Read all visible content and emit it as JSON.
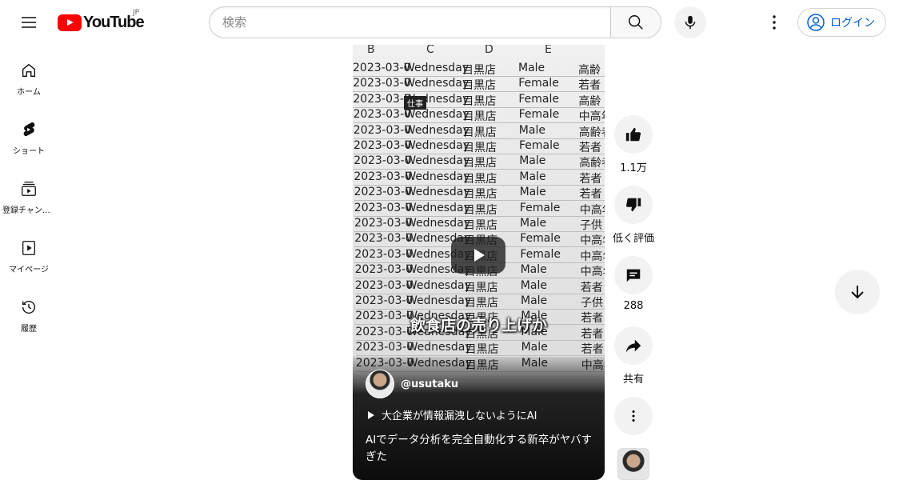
{
  "header": {
    "logo_text": "YouTube",
    "logo_region": "JP",
    "search_placeholder": "検索",
    "login_label": "ログイン"
  },
  "guide": {
    "items": [
      {
        "label": "ホーム",
        "icon": "home-icon"
      },
      {
        "label": "ショート",
        "icon": "shorts-icon"
      },
      {
        "label": "登録チャンネル",
        "icon": "subscriptions-icon"
      },
      {
        "label": "マイページ",
        "icon": "library-icon"
      },
      {
        "label": "履歴",
        "icon": "history-icon"
      }
    ]
  },
  "short": {
    "sheet_columns": [
      "B",
      "C",
      "D",
      "E"
    ],
    "sheet_tag": "仕事",
    "sheet_rows": [
      [
        "2023-03-0",
        "Wednesday",
        "目黒店",
        "Male",
        "高齢"
      ],
      [
        "2023-03-0",
        "Wednesday",
        "目黒店",
        "Female",
        "若者"
      ],
      [
        "2023-03-0",
        "Wednesday",
        "目黒店",
        "Female",
        "高齢"
      ],
      [
        "2023-03-0",
        "Wednesday",
        "目黒店",
        "Female",
        "中高年"
      ],
      [
        "2023-03-0",
        "Wednesday",
        "目黒店",
        "Male",
        "高齢者"
      ],
      [
        "2023-03-0",
        "Wednesday",
        "目黒店",
        "Female",
        "若者"
      ],
      [
        "2023-03-0",
        "Wednesday",
        "目黒店",
        "Male",
        "高齢者"
      ],
      [
        "2023-03-0",
        "Wednesday",
        "目黒店",
        "Male",
        "若者"
      ],
      [
        "2023-03-0",
        "Wednesday",
        "目黒店",
        "Male",
        "若者"
      ],
      [
        "2023-03-0",
        "Wednesday",
        "目黒店",
        "Female",
        "中高年"
      ],
      [
        "2023-03-0",
        "Wednesday",
        "目黒店",
        "Male",
        "子供"
      ],
      [
        "2023-03-0",
        "Wednesday",
        "目黒店",
        "Female",
        "中高年"
      ],
      [
        "2023-03-0",
        "Wednesday",
        "目黒店",
        "Female",
        "中高年"
      ],
      [
        "2023-03-0",
        "Wednesday",
        "目黒店",
        "Male",
        "中高年"
      ],
      [
        "2023-03-0",
        "Wednesday",
        "目黒店",
        "Male",
        "若者"
      ],
      [
        "2023-03-0",
        "Wednesday",
        "目黒店",
        "Male",
        "子供"
      ],
      [
        "2023-03-0",
        "Wednesday",
        "目黒店",
        "Male",
        "若者"
      ],
      [
        "2023-03-0",
        "Wednesday",
        "目黒店",
        "Male",
        "若者"
      ],
      [
        "2023-03-0",
        "Wednesday",
        "目黒店",
        "Male",
        "若者"
      ],
      [
        "2023-03-0",
        "Wednesday",
        "目黒店",
        "Male",
        "中高年"
      ]
    ],
    "caption": "飲食店の売り上げか",
    "channel_name": "@usutaku",
    "playlist_label": "大企業が情報漏洩しないようにAI",
    "title": "AIでデータ分析を完全自動化する新卒がヤバすぎた"
  },
  "actions": {
    "like_count": "1.1万",
    "dislike_label": "低く評価",
    "comment_count": "288",
    "share_label": "共有"
  }
}
